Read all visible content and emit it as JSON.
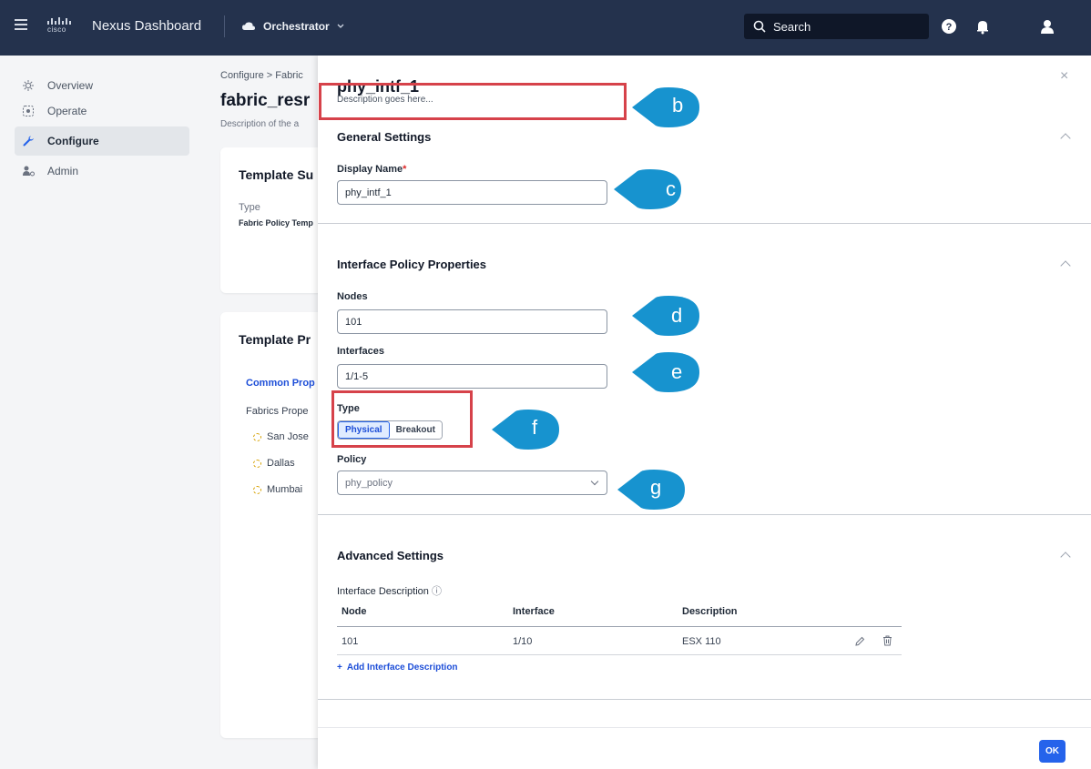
{
  "topbar": {
    "logo_text": "cisco",
    "product": "Nexus Dashboard",
    "app": "Orchestrator",
    "search_label": "Search"
  },
  "sidebar": {
    "items": [
      {
        "label": "Overview",
        "icon": "overview-icon"
      },
      {
        "label": "Operate",
        "icon": "operate-icon"
      },
      {
        "label": "Configure",
        "icon": "wrench-icon",
        "active": true
      },
      {
        "label": "Admin",
        "icon": "admin-icon"
      }
    ]
  },
  "background": {
    "breadcrumb": "Configure  >  Fabric",
    "title": "fabric_resr",
    "description": "Description of the a",
    "summary_card": {
      "title": "Template Su",
      "type_label": "Type",
      "type_value": "Fabric Policy Temp"
    },
    "properties_card": {
      "title": "Template Pr",
      "common_link": "Common Prop",
      "fabrics_label": "Fabrics Prope",
      "sites": [
        "San Jose",
        "Dallas",
        "Mumbai"
      ]
    }
  },
  "drawer": {
    "title": "phy_intf_1",
    "description_placeholder": "Description goes here...",
    "general": {
      "title": "General Settings",
      "display_name_label": "Display Name",
      "required_mark": "*",
      "display_name_value": "phy_intf_1"
    },
    "interface_policy": {
      "title": "Interface Policy Properties",
      "nodes_label": "Nodes",
      "nodes_value": "101",
      "interfaces_label": "Interfaces",
      "interfaces_value": "1/1-5",
      "type_label": "Type",
      "type_options": [
        "Physical",
        "Breakout"
      ],
      "type_selected": "Physical",
      "policy_label": "Policy",
      "policy_value": "phy_policy"
    },
    "advanced": {
      "title": "Advanced Settings",
      "interface_description_label": "Interface Description",
      "info_icon": "ⓘ",
      "columns": [
        "Node",
        "Interface",
        "Description"
      ],
      "rows": [
        {
          "node": "101",
          "interface": "1/10",
          "description": "ESX 110"
        }
      ],
      "add_label": "Add Interface Description",
      "add_symbol": "+"
    },
    "ok_label": "OK",
    "close_symbol": "×"
  },
  "annotations": {
    "b": "b",
    "c": "c",
    "d": "d",
    "e": "e",
    "f": "f",
    "g": "g"
  },
  "colors": {
    "topbar": "#24324d",
    "accent": "#2563eb",
    "callout": "#1793cf",
    "highlight": "#d6424a"
  }
}
